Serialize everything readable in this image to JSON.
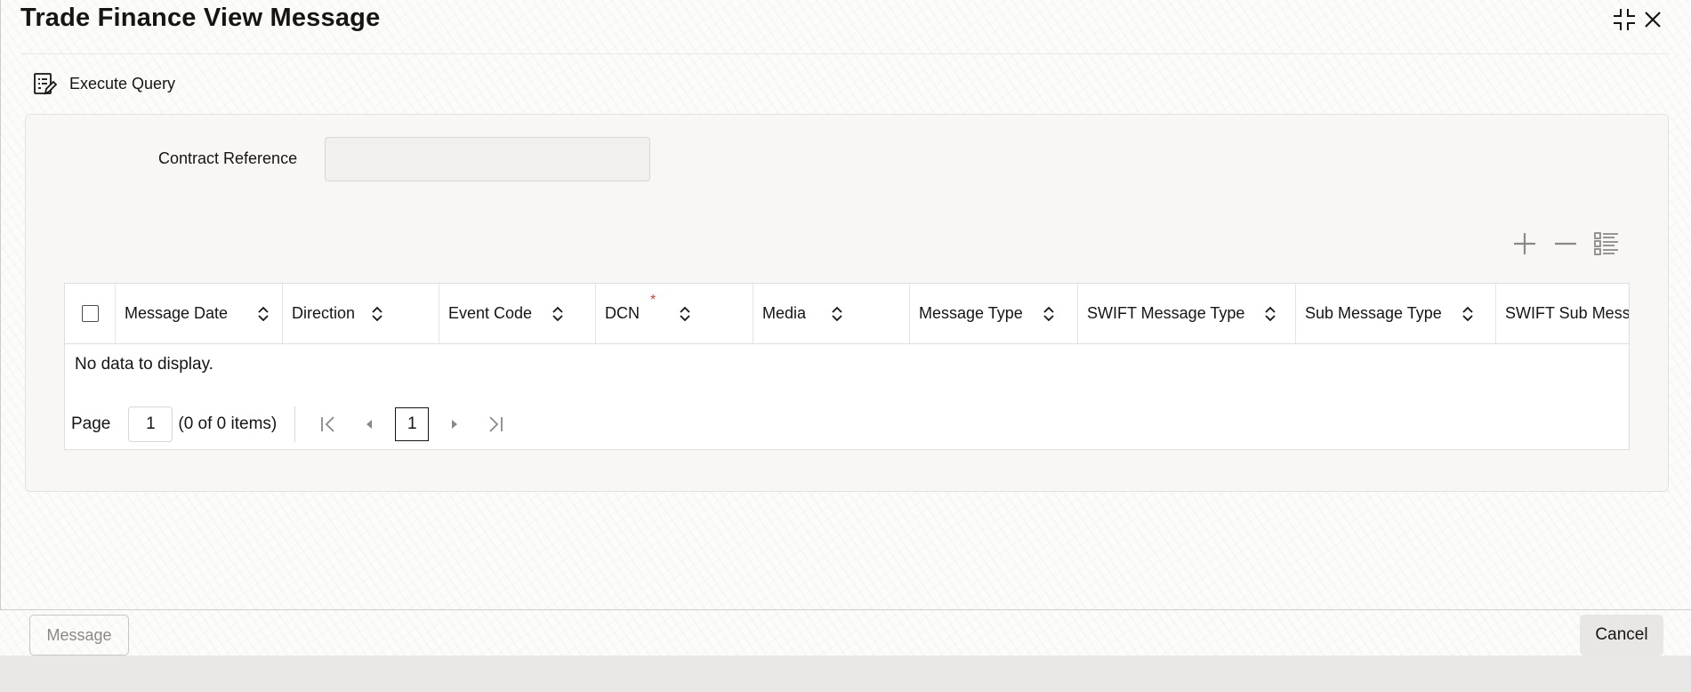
{
  "window": {
    "title": "Trade Finance View Message",
    "icons": {
      "restore": "restore-icon",
      "close": "close-icon"
    }
  },
  "toolbar": {
    "execute_query_label": "Execute Query",
    "execute_query_icon": "execute-query-icon"
  },
  "form": {
    "contract_reference_label": "Contract Reference",
    "contract_reference_value": ""
  },
  "grid_tools": {
    "add_icon": "plus-icon",
    "remove_icon": "minus-icon",
    "columns_icon": "column-list-icon"
  },
  "table": {
    "columns": [
      {
        "label": "Message Date",
        "required": false
      },
      {
        "label": "Direction",
        "required": false
      },
      {
        "label": "Event Code",
        "required": false
      },
      {
        "label": "DCN",
        "required": true
      },
      {
        "label": "Media",
        "required": false
      },
      {
        "label": "Message Type",
        "required": false
      },
      {
        "label": "SWIFT Message Type",
        "required": false
      },
      {
        "label": "Sub Message Type",
        "required": false
      },
      {
        "label": "SWIFT Sub Message",
        "required": false
      }
    ],
    "required_marker": "*",
    "empty_text": "No data to display.",
    "rows": []
  },
  "pagination": {
    "page_label": "Page",
    "page_value": "1",
    "items_summary": "(0 of 0 items)",
    "current_page": "1"
  },
  "footer": {
    "message_button": "Message",
    "cancel_button": "Cancel"
  },
  "colors": {
    "required": "#c74634",
    "text": "#161513",
    "disabled_text": "#8b8985"
  }
}
